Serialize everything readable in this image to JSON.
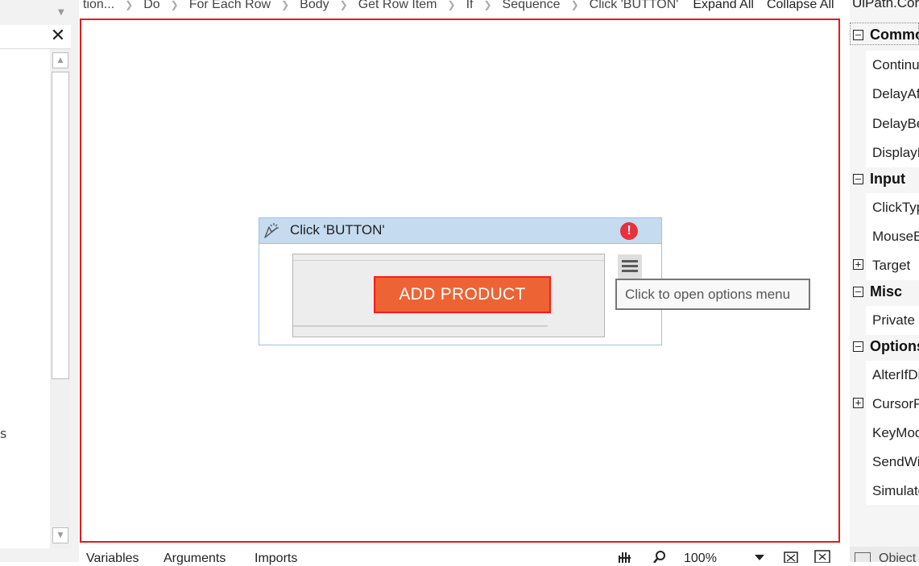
{
  "breadcrumb": {
    "items": [
      "tion...",
      "Do",
      "For Each Row",
      "Body",
      "Get Row Item",
      "If",
      "Sequence",
      "Click 'BUTTON'"
    ],
    "expand_all": "Expand All",
    "collapse_all": "Collapse All"
  },
  "left_panel": {
    "partial_text": "s"
  },
  "activity": {
    "title": "Click 'BUTTON'",
    "icon": "click-icon",
    "status_icon": "error-icon",
    "target_button_label": "ADD PRODUCT"
  },
  "tooltip": {
    "text": "Click to open options menu"
  },
  "bottom_bar": {
    "variables": "Variables",
    "arguments": "Arguments",
    "imports": "Imports",
    "zoom": "100%"
  },
  "properties": {
    "title": "UiPath.Core",
    "rows": [
      {
        "type": "category",
        "label": "Common",
        "expander": "⊟"
      },
      {
        "type": "item",
        "label": "ContinueOnError"
      },
      {
        "type": "item",
        "label": "DelayAfter"
      },
      {
        "type": "item",
        "label": "DelayBefore"
      },
      {
        "type": "item",
        "label": "DisplayName"
      },
      {
        "type": "category",
        "label": "Input",
        "expander": "⊟"
      },
      {
        "type": "item",
        "label": "ClickType"
      },
      {
        "type": "item",
        "label": "MouseButton"
      },
      {
        "type": "item",
        "label": "Target",
        "expandable": true
      },
      {
        "type": "category",
        "label": "Misc",
        "expander": "⊟"
      },
      {
        "type": "item",
        "label": "Private"
      },
      {
        "type": "category",
        "label": "Options",
        "expander": "⊟"
      },
      {
        "type": "item",
        "label": "AlterIfDisabled"
      },
      {
        "type": "item",
        "label": "CursorPosition",
        "expandable": true
      },
      {
        "type": "item",
        "label": "KeyModifiers"
      },
      {
        "type": "item",
        "label": "SendWindowMessages"
      },
      {
        "type": "item",
        "label": "SimulateClick"
      }
    ],
    "bottom_tab": "Object"
  },
  "colors": {
    "canvas_border": "#e31b1b",
    "activity_header": "#c5dbef",
    "target_button": "#ee6333",
    "error": "#e8313d"
  }
}
